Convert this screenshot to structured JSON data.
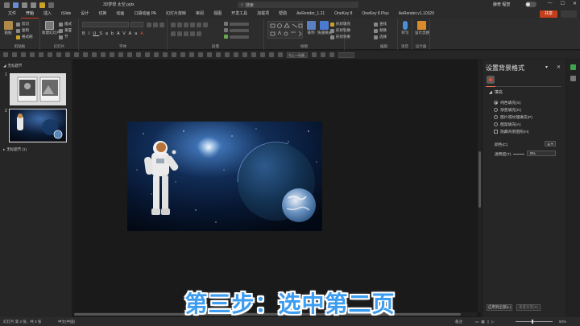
{
  "window": {
    "doc_title": "3D梦想 太空.pptx",
    "search_placeholder": "搜索",
    "user": "薛奇 程智",
    "minimize": "—",
    "maximize": "☐",
    "close": "✕"
  },
  "tabs": [
    "文件",
    "开始",
    "插入",
    "iSlide",
    "设计",
    "切换",
    "动画",
    "口袋动画 PA",
    "幻灯片放映",
    "审阅",
    "视图",
    "开发工具",
    "加载项",
    "帮助",
    "AeRender_1.21",
    "OneKey 8",
    "OneKey 8 Plus",
    "AeRender.v1.10329"
  ],
  "active_tab": "开始",
  "share_label": "共享",
  "ribbon": {
    "clipboard": {
      "paste": "粘贴",
      "cut": "剪切",
      "copy": "复制",
      "format_painter": "格式刷",
      "label": "剪贴板"
    },
    "slides": {
      "new_slide": "新建幻灯片",
      "layout": "版式",
      "reset": "重置",
      "section": "节",
      "label": "幻灯片"
    },
    "font": {
      "label": "字体"
    },
    "paragraph": {
      "label": "段落"
    },
    "drawing": {
      "arrange": "排列",
      "quick_styles": "快速样式",
      "fill": "形状填充",
      "outline": "形状轮廓",
      "effect": "形状效果",
      "label": "绘图"
    },
    "editing": {
      "find": "查找",
      "replace": "替换",
      "select": "选择",
      "label": "编辑"
    },
    "voice": {
      "dictate": "听写",
      "label": "语音"
    },
    "designer": {
      "ideas": "设计灵感",
      "label": "设计器"
    }
  },
  "toolbar2": {
    "dropdown": "与上一动画"
  },
  "slides_panel": {
    "section1": "无标题节",
    "section2": "无标题节 (1)",
    "slide1_num": "1",
    "slide2_num": "2"
  },
  "format_pane": {
    "title": "设置背景格式",
    "fill_header": "填充",
    "options": [
      "纯色填充(S)",
      "渐变填充(G)",
      "图片或纹理填充(P)",
      "图案填充(A)"
    ],
    "selected_option": 0,
    "hide_bg": "隐藏背景图形(H)",
    "color_label": "颜色(C)",
    "transparency_label": "透明度(T)",
    "transparency_value": "0%",
    "apply_all": "应用到全部(L)",
    "reset_bg": "重置背景(B)"
  },
  "status": {
    "slide_info": "幻灯片 第 2 张，共 3 张",
    "language": "中文(中国)",
    "notes": "备注",
    "zoom": "50%"
  },
  "caption": "第三步：选中第二页",
  "colors": {
    "accent": "#c43e1c",
    "caption": "#3d9df0"
  }
}
